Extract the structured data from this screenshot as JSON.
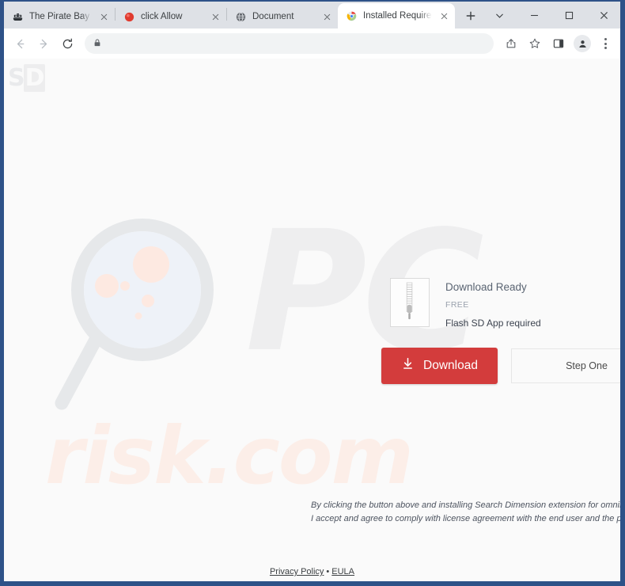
{
  "browser": {
    "tabs": [
      {
        "title": "The Pirate Bay - The gala",
        "favicon": "ship-icon",
        "active": false
      },
      {
        "title": "click Allow",
        "favicon": "red-circle-icon",
        "active": false
      },
      {
        "title": "Document",
        "favicon": "globe-icon",
        "active": false
      },
      {
        "title": "Installed Required",
        "favicon": "chrome-icon",
        "active": true
      }
    ],
    "new_tab_label": "+",
    "window_controls": {
      "list_label": "⌄",
      "minimize_label": "—",
      "maximize_label": "□",
      "close_label": "✕"
    },
    "toolbar": {
      "back_icon": "back-arrow-icon",
      "forward_icon": "forward-arrow-icon",
      "reload_icon": "reload-icon",
      "lock_icon": "lock-icon",
      "url": "",
      "url_placeholder": "",
      "share_icon": "share-icon",
      "bookmark_icon": "star-icon",
      "side_panel_icon": "side-panel-icon",
      "profile_icon": "profile-avatar-icon",
      "menu_icon": "three-dot-menu-icon"
    }
  },
  "page": {
    "logo_text_s": "S",
    "logo_text_d": "D",
    "watermark_pc": "PC",
    "watermark_risk": "risk.com",
    "product": {
      "title": "Download Ready",
      "price": "FREE",
      "requirement": "Flash SD App required",
      "icon": "zip-archive-icon"
    },
    "download_button": {
      "label": "Download",
      "icon": "download-arrow-icon",
      "color": "#d33c3c"
    },
    "step_panel": {
      "label": "Step One"
    },
    "disclaimer": {
      "line1": "By clicking the button above and installing Search Dimension extension for omnibox",
      "line2": "I accept and agree to comply with license agreement with the end user and the privacy p"
    },
    "footer": {
      "privacy_label": "Privacy Policy",
      "separator": "•",
      "eula_label": "EULA"
    }
  }
}
